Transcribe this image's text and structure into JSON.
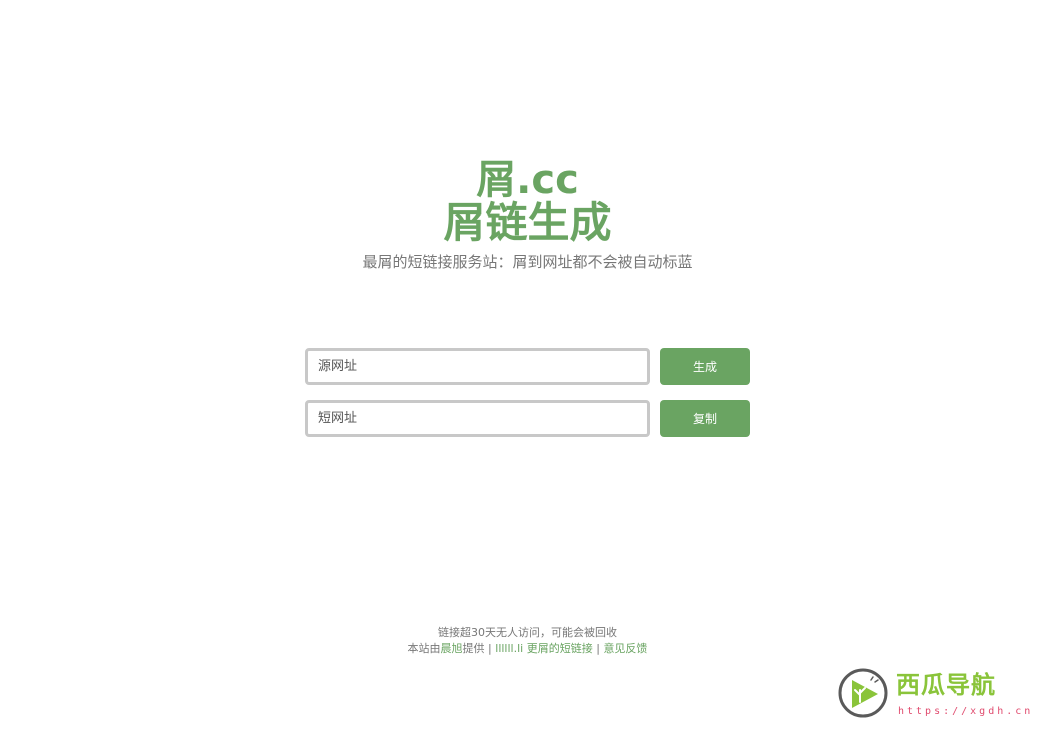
{
  "header": {
    "logo_line1": "屑.cc",
    "logo_line2": "屑链生成",
    "tagline": "最屑的短链接服务站：屑到网址都不会被自动标蓝"
  },
  "form": {
    "source_placeholder": "源网址",
    "short_placeholder": "短网址",
    "generate_label": "生成",
    "copy_label": "复制"
  },
  "footer": {
    "notice": "链接超30天无人访问，可能会被回收",
    "provided_prefix": "本站由",
    "provider_link": "晨旭",
    "provided_suffix": "提供",
    "separator": "|",
    "link_2": "llllll.li",
    "link_3": "更屑的短链接",
    "link_4": "意见反馈"
  },
  "watermark": {
    "title": "西瓜导航",
    "url": "https://xgdh.cn"
  },
  "colors": {
    "accent": "#6aa462",
    "text_muted": "#777777",
    "input_border": "#c8c8c8",
    "watermark_green": "#8ac43a",
    "watermark_pink": "#e04b6e"
  }
}
